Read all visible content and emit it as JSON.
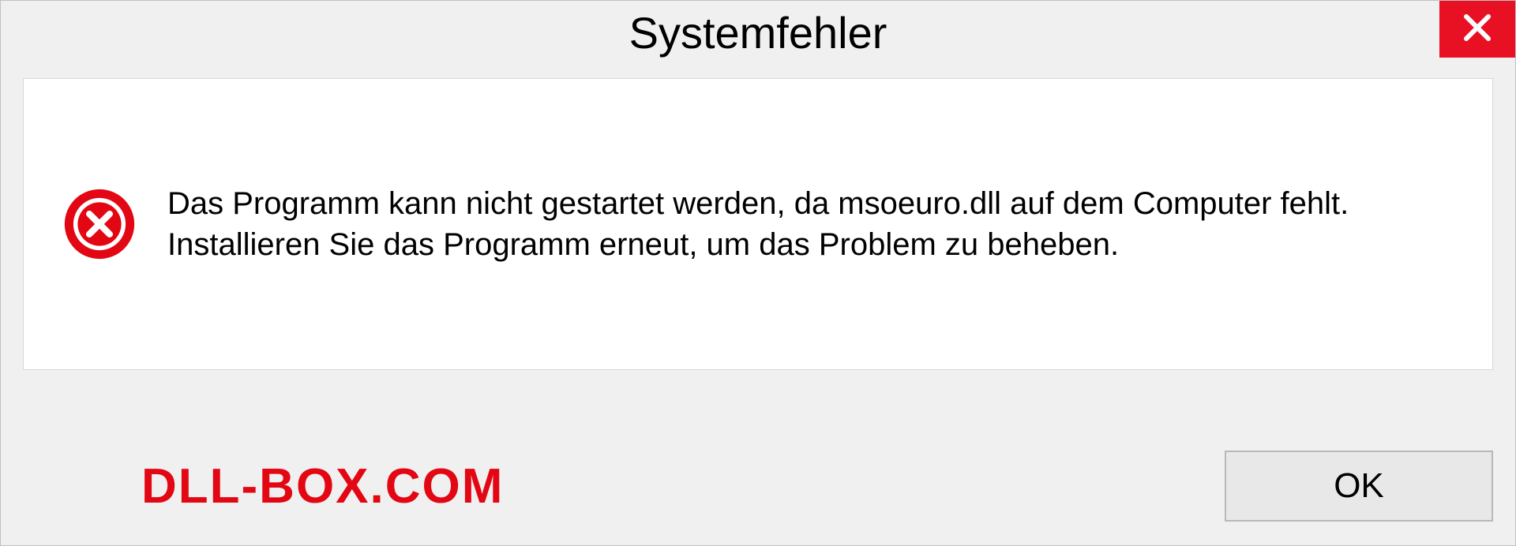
{
  "dialog": {
    "title": "Systemfehler",
    "message": "Das Programm kann nicht gestartet werden, da msoeuro.dll auf dem Computer fehlt. Installieren Sie das Programm erneut, um das Problem zu beheben.",
    "ok_label": "OK"
  },
  "watermark": "DLL-BOX.COM",
  "colors": {
    "close_button": "#e81123",
    "error_icon": "#e30613",
    "watermark": "#e30613"
  }
}
